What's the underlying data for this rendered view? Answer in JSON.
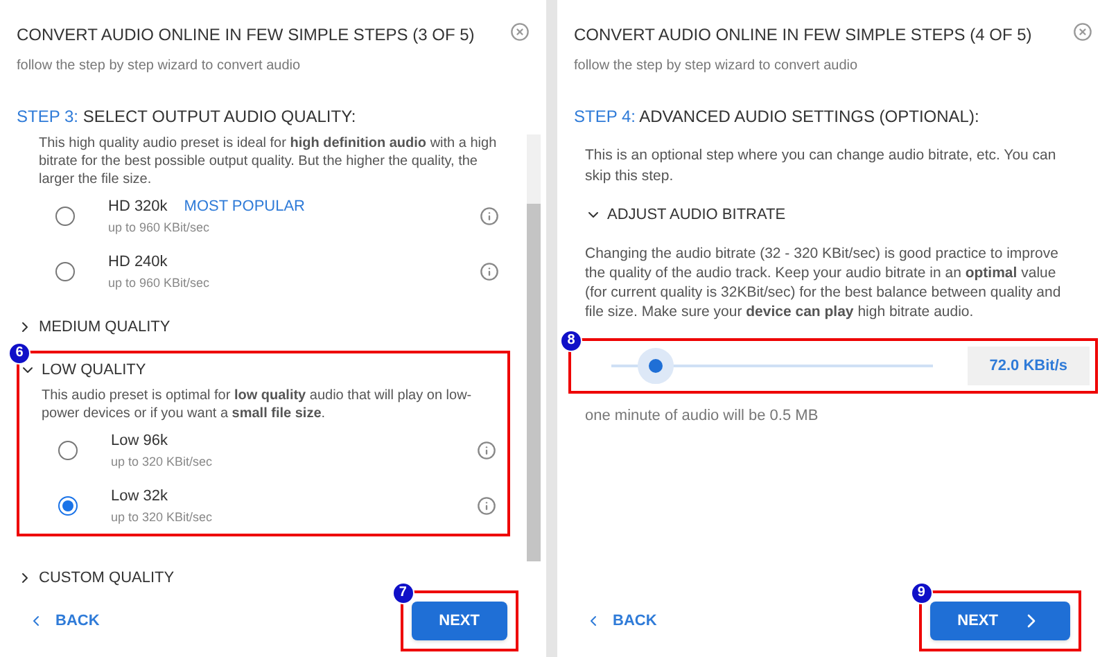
{
  "left_panel": {
    "title": "CONVERT AUDIO ONLINE IN FEW SIMPLE STEPS (3 OF 5)",
    "subtitle": "follow the step by step wizard to convert audio",
    "step_number": "STEP 3:",
    "step_title": "SELECT OUTPUT AUDIO QUALITY:",
    "intro": "This high quality audio preset is ideal for **high definition audio** with a high bitrate for the best possible output quality. But the higher the quality, the larger the file size.",
    "options": [
      {
        "label": "HD 320k",
        "tag": "MOST POPULAR",
        "rate": "up to 960 KBit/sec",
        "selected": false
      },
      {
        "label": "HD 240k",
        "rate": "up to 960 KBit/sec",
        "selected": false
      }
    ],
    "sections": [
      {
        "label": "MEDIUM QUALITY",
        "expanded": false
      },
      {
        "label": "LOW QUALITY",
        "expanded": true,
        "callout": "6",
        "description": "This audio preset is optimal for **low quality** audio that will play on low-power devices or if you want a **small file size**.",
        "options": [
          {
            "label": "Low 96k",
            "rate": "up to 320 KBit/sec",
            "selected": false
          },
          {
            "label": "Low 32k",
            "rate": "up to 320 KBit/sec",
            "selected": true
          }
        ]
      }
    ],
    "footer_section": {
      "label": "CUSTOM QUALITY",
      "expanded": false
    },
    "back": "BACK",
    "next": "NEXT",
    "next_callout": "7"
  },
  "right_panel": {
    "title": "CONVERT AUDIO ONLINE IN FEW SIMPLE STEPS (4 OF 5)",
    "subtitle": "follow the step by step wizard to convert audio",
    "step_number": "STEP 4:",
    "step_title": "ADVANCED AUDIO SETTINGS (OPTIONAL):",
    "intro": "This is an optional step where you can change audio bitrate, etc. You can skip this step.",
    "section": {
      "label": "ADJUST AUDIO BITRATE",
      "expanded": true,
      "description": "Changing the audio bitrate (32 - 320 KBit/sec) is good practice to improve the quality of the audio track. Keep your audio bitrate in an **optimal** value (for current quality is 32KBit/sec) for the best balance between quality and file size. Make sure your **device can play** high bitrate audio."
    },
    "slider": {
      "level": 0.14,
      "reading": "72.0 KBit/s",
      "callout": "8"
    },
    "size_note": "one minute of audio will be 0.5 MB",
    "back": "BACK",
    "next": "NEXT",
    "next_callout": "9"
  }
}
